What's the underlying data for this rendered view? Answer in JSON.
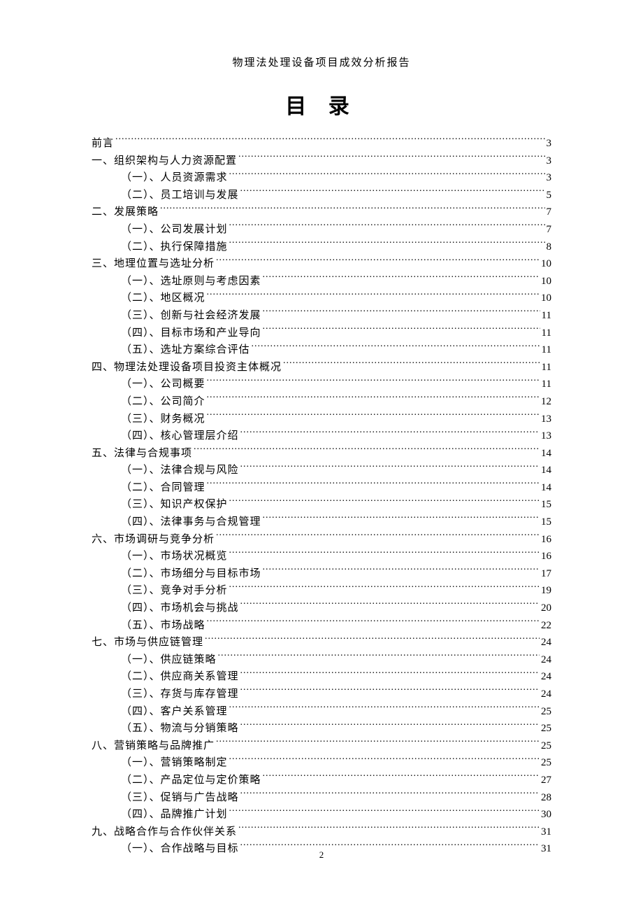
{
  "header": "物理法处理设备项目成效分析报告",
  "toc_title": "目 录",
  "page_number": "2",
  "entries": [
    {
      "level": 0,
      "label": "前言",
      "page": "3"
    },
    {
      "level": 0,
      "label": "一、组织架构与人力资源配置",
      "page": "3"
    },
    {
      "level": 1,
      "label": "（一）、人员资源需求",
      "page": "3"
    },
    {
      "level": 1,
      "label": "（二）、员工培训与发展",
      "page": "5"
    },
    {
      "level": 0,
      "label": "二、发展策略",
      "page": "7"
    },
    {
      "level": 1,
      "label": "（一）、公司发展计划",
      "page": "7"
    },
    {
      "level": 1,
      "label": "（二）、执行保障措施",
      "page": "8"
    },
    {
      "level": 0,
      "label": "三、地理位置与选址分析",
      "page": "10"
    },
    {
      "level": 1,
      "label": "（一）、选址原则与考虑因素",
      "page": "10"
    },
    {
      "level": 1,
      "label": "（二）、地区概况",
      "page": "10"
    },
    {
      "level": 1,
      "label": "（三）、创新与社会经济发展",
      "page": "11"
    },
    {
      "level": 1,
      "label": "（四）、目标市场和产业导向",
      "page": "11"
    },
    {
      "level": 1,
      "label": "（五）、选址方案综合评估",
      "page": "11"
    },
    {
      "level": 0,
      "label": "四、物理法处理设备项目投资主体概况",
      "page": "11"
    },
    {
      "level": 1,
      "label": "（一）、公司概要",
      "page": "11"
    },
    {
      "level": 1,
      "label": "（二）、公司简介",
      "page": "12"
    },
    {
      "level": 1,
      "label": "（三）、财务概况",
      "page": "13"
    },
    {
      "level": 1,
      "label": "（四）、核心管理层介绍",
      "page": "13"
    },
    {
      "level": 0,
      "label": "五、法律与合规事项",
      "page": "14"
    },
    {
      "level": 1,
      "label": "（一）、法律合规与风险",
      "page": "14"
    },
    {
      "level": 1,
      "label": "（二）、合同管理",
      "page": "14"
    },
    {
      "level": 1,
      "label": "（三）、知识产权保护",
      "page": "15"
    },
    {
      "level": 1,
      "label": "（四）、法律事务与合规管理",
      "page": "15"
    },
    {
      "level": 0,
      "label": "六、市场调研与竞争分析",
      "page": "16"
    },
    {
      "level": 1,
      "label": "（一）、市场状况概览",
      "page": "16"
    },
    {
      "level": 1,
      "label": "（二）、市场细分与目标市场",
      "page": "17"
    },
    {
      "level": 1,
      "label": "（三）、竞争对手分析",
      "page": "19"
    },
    {
      "level": 1,
      "label": "（四）、市场机会与挑战",
      "page": "20"
    },
    {
      "level": 1,
      "label": "（五）、市场战略",
      "page": "22"
    },
    {
      "level": 0,
      "label": "七、市场与供应链管理",
      "page": "24"
    },
    {
      "level": 1,
      "label": "（一）、供应链策略",
      "page": "24"
    },
    {
      "level": 1,
      "label": "（二）、供应商关系管理",
      "page": "24"
    },
    {
      "level": 1,
      "label": "（三）、存货与库存管理",
      "page": "24"
    },
    {
      "level": 1,
      "label": "（四）、客户关系管理",
      "page": "25"
    },
    {
      "level": 1,
      "label": "（五）、物流与分销策略",
      "page": "25"
    },
    {
      "level": 0,
      "label": "八、营销策略与品牌推广",
      "page": "25"
    },
    {
      "level": 1,
      "label": "（一）、营销策略制定",
      "page": "25"
    },
    {
      "level": 1,
      "label": "（二）、产品定位与定价策略",
      "page": "27"
    },
    {
      "level": 1,
      "label": "（三）、促销与广告战略",
      "page": "28"
    },
    {
      "level": 1,
      "label": "（四）、品牌推广计划",
      "page": "30"
    },
    {
      "level": 0,
      "label": "九、战略合作与合作伙伴关系",
      "page": "31"
    },
    {
      "level": 1,
      "label": "（一）、合作战略与目标",
      "page": "31"
    }
  ]
}
